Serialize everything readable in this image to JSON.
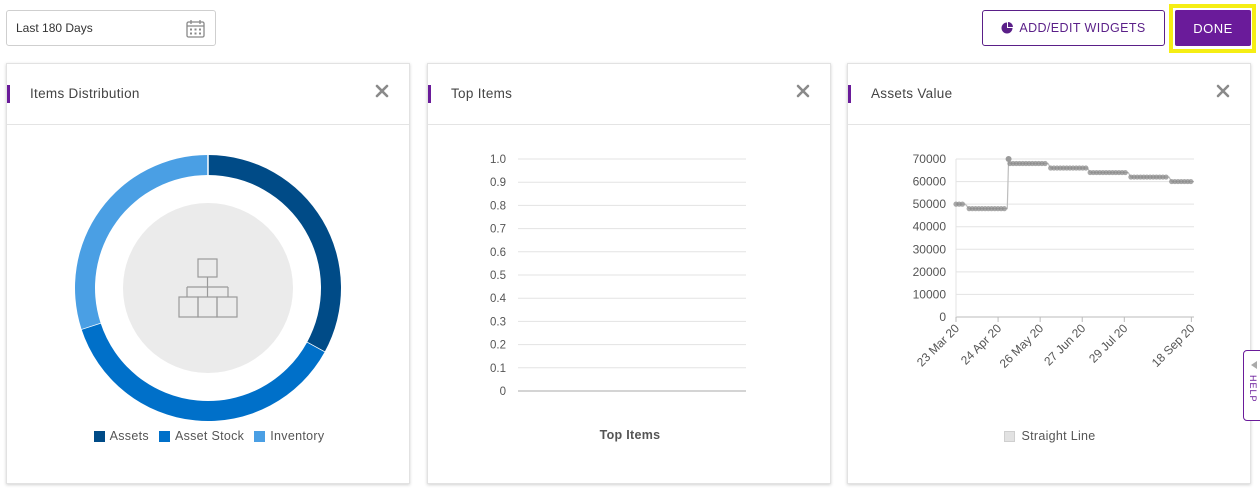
{
  "toolbar": {
    "date_range": "Last 180 Days",
    "add_edit_label": "ADD/EDIT WIDGETS",
    "done_label": "DONE",
    "help_label": "HELP"
  },
  "colors": {
    "brand": "#6a1b9a",
    "highlight": "#f5ee14",
    "assets": "#004b87",
    "asset_stock": "#0070c9",
    "inventory": "#4a9fe4",
    "line": "#999999"
  },
  "icons": {
    "date": "calendar-icon",
    "widgets": "pie-chart-icon",
    "close": "close-icon",
    "empty": "hierarchy-icon",
    "help_arrow": "triangle-left-icon"
  },
  "widgets": {
    "items_distribution": {
      "title": "Items Distribution",
      "legend": [
        "Assets",
        "Asset Stock",
        "Inventory"
      ]
    },
    "top_items": {
      "title": "Top Items",
      "xlabel": "Top Items"
    },
    "assets_value": {
      "title": "Assets Value",
      "legend": "Straight Line"
    }
  },
  "chart_data": [
    {
      "type": "pie",
      "variant": "donut",
      "title": "Items Distribution",
      "categories": [
        "Assets",
        "Asset Stock",
        "Inventory"
      ],
      "values": [
        33,
        37,
        30
      ],
      "legend": "bottom"
    },
    {
      "type": "bar",
      "title": "Top Items",
      "categories": [],
      "values": [],
      "xlabel": "Top Items",
      "ylabel": "",
      "ylim": [
        0,
        1.0
      ],
      "yticks": [
        "0",
        "0.1",
        "0.2",
        "0.3",
        "0.4",
        "0.5",
        "0.6",
        "0.7",
        "0.8",
        "0.9",
        "1.0"
      ],
      "grid": true
    },
    {
      "type": "line",
      "title": "Assets Value",
      "xticks": [
        "23 Mar 20",
        "24 Apr 20",
        "26 May 20",
        "27 Jun 20",
        "29 Jul 20",
        "18 Sep 20"
      ],
      "yticks": [
        "0",
        "10000",
        "20000",
        "30000",
        "40000",
        "50000",
        "60000",
        "70000"
      ],
      "ylim": [
        0,
        70000
      ],
      "grid": true,
      "legend": "bottom",
      "series": [
        {
          "name": "Straight Line",
          "points": [
            [
              "2020-03-23",
              50000
            ],
            [
              "2020-03-30",
              50000
            ],
            [
              "2020-04-02",
              48000
            ],
            [
              "2020-05-01",
              48000
            ],
            [
              "2020-05-02",
              70000
            ],
            [
              "2020-05-03",
              68000
            ],
            [
              "2020-06-01",
              68000
            ],
            [
              "2020-06-03",
              66000
            ],
            [
              "2020-07-01",
              66000
            ],
            [
              "2020-07-03",
              64000
            ],
            [
              "2020-08-01",
              64000
            ],
            [
              "2020-08-03",
              62000
            ],
            [
              "2020-09-01",
              62000
            ],
            [
              "2020-09-03",
              60000
            ],
            [
              "2020-09-20",
              60000
            ]
          ]
        }
      ]
    }
  ]
}
